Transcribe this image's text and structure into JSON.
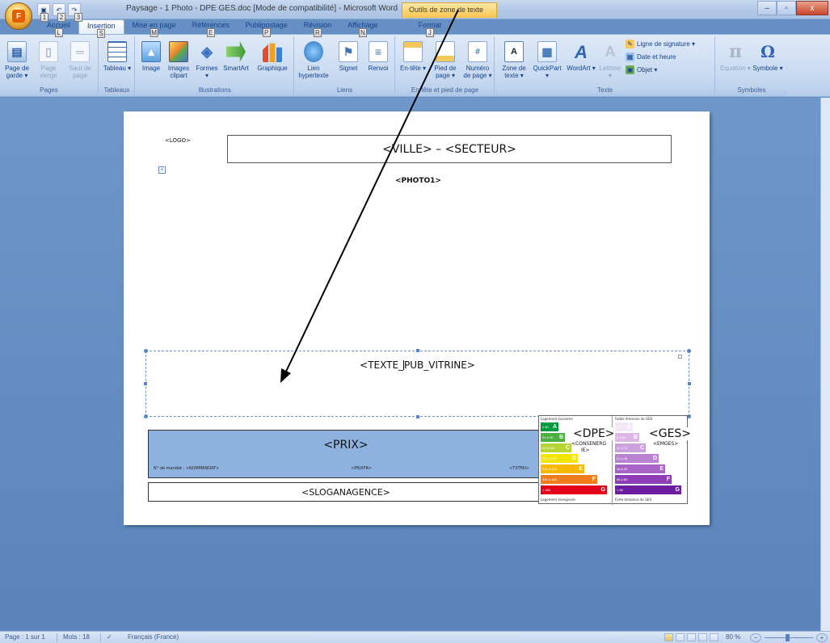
{
  "window": {
    "title": "Paysage - 1 Photo - DPE GES.doc [Mode de compatibilité] - Microsoft Word",
    "tool_tab": "Outils de zone de texte",
    "minimize": "–",
    "maximize": "▫",
    "close": "x"
  },
  "qat": {
    "badges": [
      "1",
      "2",
      "3"
    ]
  },
  "tabs": [
    {
      "label": "Accueil",
      "keytip": "L"
    },
    {
      "label": "Insertion",
      "keytip": "S"
    },
    {
      "label": "Mise en page",
      "keytip": "M"
    },
    {
      "label": "Références",
      "keytip": "E"
    },
    {
      "label": "Publipostage",
      "keytip": "P"
    },
    {
      "label": "Révision",
      "keytip": "R"
    },
    {
      "label": "Affichage",
      "keytip": "N"
    },
    {
      "label": "Format",
      "keytip": "J"
    }
  ],
  "ribbon": {
    "groups": {
      "pages": "Pages",
      "tableaux": "Tableaux",
      "illustrations": "Illustrations",
      "liens": "Liens",
      "entete": "En-tête et pied de page",
      "texte": "Texte",
      "symboles": "Symboles"
    },
    "buttons": {
      "page_garde": "Page de garde ▾",
      "page_vierge": "Page vierge",
      "saut_page": "Saut de page",
      "tableau": "Tableau ▾",
      "image": "Image",
      "images_clipart": "Images clipart",
      "formes": "Formes ▾",
      "smartart": "SmartArt",
      "graphique": "Graphique",
      "lien_hypertexte": "Lien hypertexte",
      "signet": "Signet",
      "renvoi": "Renvoi",
      "entete": "En-tête ▾",
      "pied_page": "Pied de page ▾",
      "numero_page": "Numéro de page ▾",
      "zone_texte": "Zone de texte ▾",
      "quickpart": "QuickPart ▾",
      "wordart": "WordArt ▾",
      "lettrine": "Lettrine ▾",
      "ligne_signature": "Ligne de signature ▾",
      "date_heure": "Date et heure",
      "objet": "Objet ▾",
      "equation": "Équation ▾",
      "symbole": "Symbole ▾"
    }
  },
  "document": {
    "logo": "<LOGO>",
    "ville_secteur": "<VILLE> – <SECTEUR>",
    "photo": "<PHOTO1>",
    "texte_pub_before": "<TEXTE_",
    "texte_pub_after": "PUB_VITRINE>",
    "prix": "<PRIX>",
    "mandat": "N° de mandat : <NUMMANDAT>",
    "prixfr": "<PRIXFR>",
    "txtfai": "<TXTFAI>",
    "slogan": "<SLOGANAGENCE>",
    "dpe": "<DPE>",
    "conso": "<CONSENERG",
    "conso2": "IE>",
    "ges": "<GES>",
    "emges": "<EMGES>",
    "dpe_header": "Logement économe",
    "dpe_footer": "Logement énergivore",
    "ges_header": "Faible émission de GES",
    "ges_footer": "Forte émission de GES",
    "dpe_bars": [
      {
        "range": "≤ 50",
        "letter": "A",
        "color": "#009a3e",
        "w": 22
      },
      {
        "range": "51 à 90",
        "letter": "B",
        "color": "#4cb040",
        "w": 30
      },
      {
        "range": "91 à 150",
        "letter": "C",
        "color": "#b6d432",
        "w": 38
      },
      {
        "range": "151 à 230",
        "letter": "D",
        "color": "#f2e500",
        "w": 46
      },
      {
        "range": "231 à 330",
        "letter": "E",
        "color": "#f5b800",
        "w": 54
      },
      {
        "range": "331 à 450",
        "letter": "F",
        "color": "#ef7d1b",
        "w": 70
      },
      {
        "range": "> 450",
        "letter": "G",
        "color": "#e3001b",
        "w": 82
      }
    ],
    "ges_bars": [
      {
        "range": "≤ 5",
        "letter": "A",
        "color": "#f3e8f6",
        "w": 22
      },
      {
        "range": "6 à 10",
        "letter": "B",
        "color": "#dcb7e6",
        "w": 30
      },
      {
        "range": "11 à 20",
        "letter": "C",
        "color": "#caa0dd",
        "w": 38
      },
      {
        "range": "21 à 35",
        "letter": "D",
        "color": "#b982d2",
        "w": 54
      },
      {
        "range": "36 à 55",
        "letter": "E",
        "color": "#a763c6",
        "w": 62
      },
      {
        "range": "56 à 80",
        "letter": "F",
        "color": "#8f3db6",
        "w": 70
      },
      {
        "range": "> 80",
        "letter": "G",
        "color": "#6d1ea0",
        "w": 82
      }
    ]
  },
  "statusbar": {
    "page": "Page : 1 sur 1",
    "words": "Mots : 18",
    "language": "Français (France)",
    "zoom": "80 %"
  }
}
